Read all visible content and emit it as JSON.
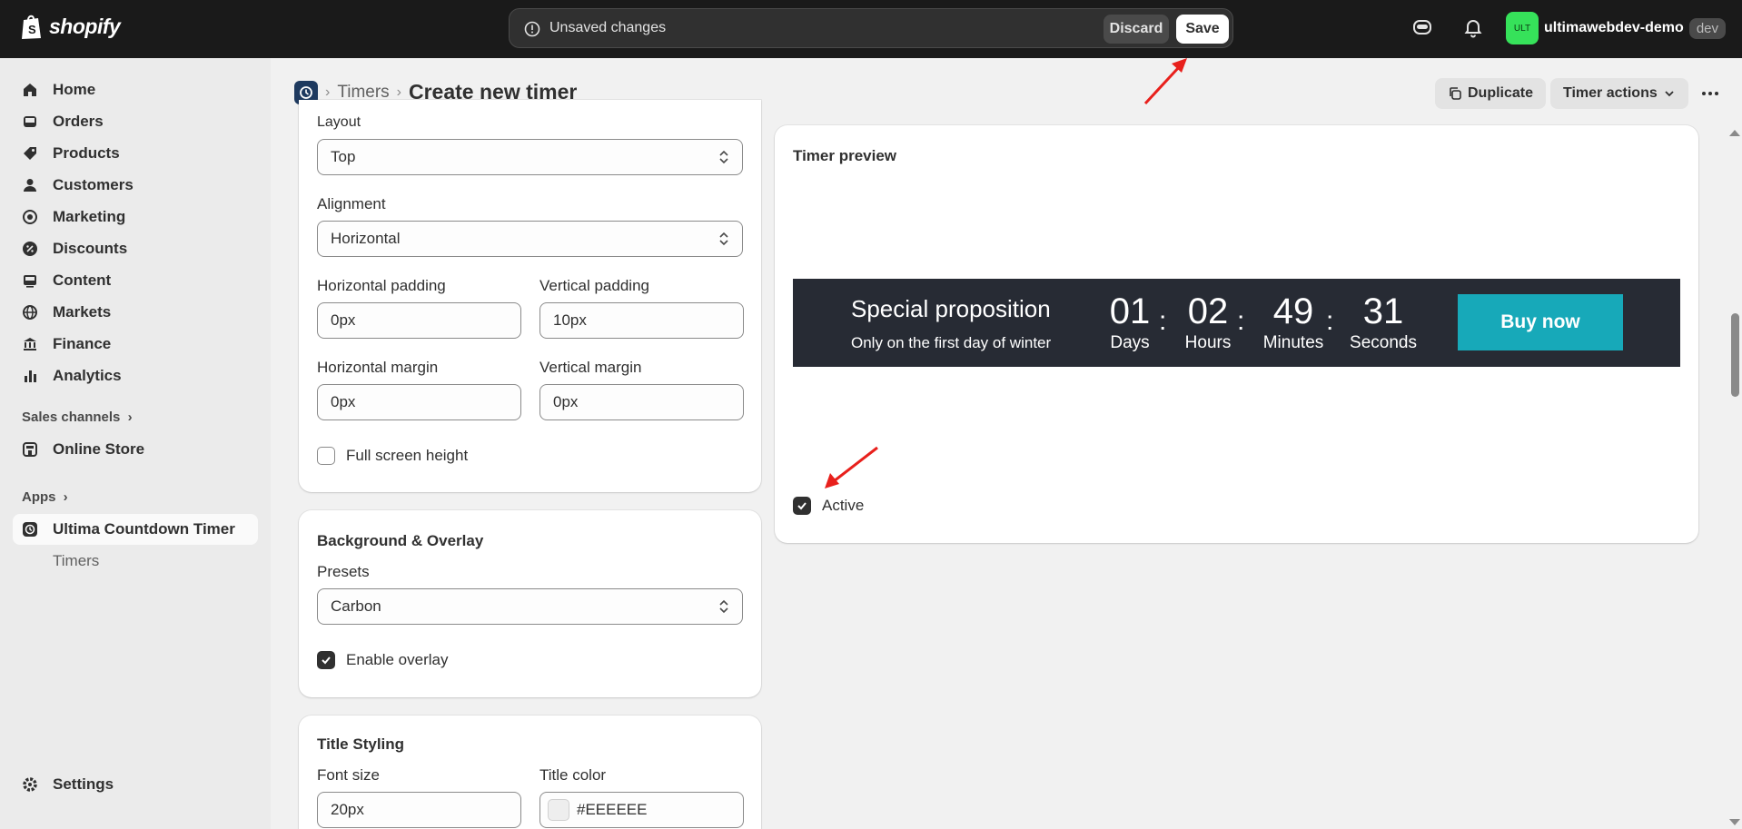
{
  "topbar": {
    "brand": "shopify",
    "unsaved_message": "Unsaved changes",
    "discard_label": "Discard",
    "save_label": "Save",
    "store_initials": "ULT",
    "store_name": "ultimawebdev-demo",
    "store_badge": "dev"
  },
  "sidebar": {
    "items": [
      {
        "label": "Home",
        "icon": "home-icon"
      },
      {
        "label": "Orders",
        "icon": "inbox-icon"
      },
      {
        "label": "Products",
        "icon": "tag-icon"
      },
      {
        "label": "Customers",
        "icon": "person-icon"
      },
      {
        "label": "Marketing",
        "icon": "target-icon"
      },
      {
        "label": "Discounts",
        "icon": "discount-icon"
      },
      {
        "label": "Content",
        "icon": "content-icon"
      },
      {
        "label": "Markets",
        "icon": "globe-icon"
      },
      {
        "label": "Finance",
        "icon": "bank-icon"
      },
      {
        "label": "Analytics",
        "icon": "bar-chart-icon"
      }
    ],
    "sales_channels_label": "Sales channels",
    "online_store_label": "Online Store",
    "apps_label": "Apps",
    "app_label": "Ultima Countdown Timer",
    "app_sub_label": "Timers",
    "settings_label": "Settings"
  },
  "header": {
    "breadcrumb": "Timers",
    "title": "Create new timer",
    "duplicate_label": "Duplicate",
    "actions_label": "Timer actions"
  },
  "layout_card": {
    "layout_label": "Layout",
    "layout_value": "Top",
    "alignment_label": "Alignment",
    "alignment_value": "Horizontal",
    "h_padding_label": "Horizontal padding",
    "h_padding_value": "0px",
    "v_padding_label": "Vertical padding",
    "v_padding_value": "10px",
    "h_margin_label": "Horizontal margin",
    "h_margin_value": "0px",
    "v_margin_label": "Vertical margin",
    "v_margin_value": "0px",
    "full_height_label": "Full screen height",
    "full_height_checked": false
  },
  "background_card": {
    "title": "Background & Overlay",
    "presets_label": "Presets",
    "presets_value": "Carbon",
    "overlay_label": "Enable overlay",
    "overlay_checked": true
  },
  "title_card": {
    "title": "Title Styling",
    "font_size_label": "Font size",
    "font_size_value": "20px",
    "title_color_label": "Title color",
    "title_color_value": "#EEEEEE"
  },
  "preview": {
    "heading": "Timer preview",
    "banner_title": "Special proposition",
    "banner_subtitle": "Only on the first day of winter",
    "days": "01",
    "days_label": "Days",
    "hours": "02",
    "hours_label": "Hours",
    "minutes": "49",
    "minutes_label": "Minutes",
    "seconds": "31",
    "seconds_label": "Seconds",
    "buy_label": "Buy now",
    "active_label": "Active",
    "active_checked": true
  },
  "colors": {
    "topbar_bg": "#1a1a1a",
    "banner_bg": "#272b34",
    "buy_button": "#17a9b9",
    "annotation_arrow": "#e8201c",
    "store_avatar": "#36e25a"
  }
}
